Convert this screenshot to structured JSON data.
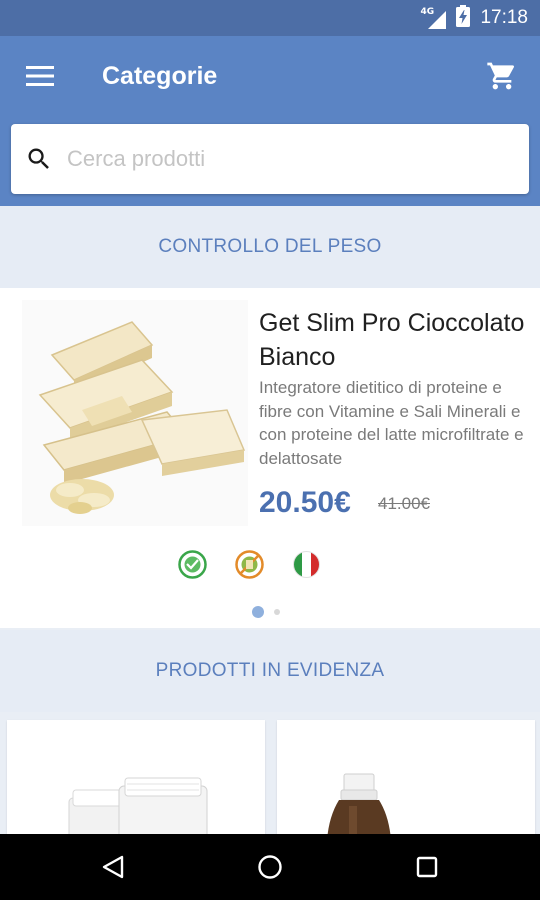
{
  "status_bar": {
    "network": "4G",
    "time": "17:18",
    "icons": [
      "signal-icon",
      "battery-charging-icon"
    ]
  },
  "app_bar": {
    "title": "Categorie",
    "icons": [
      "menu-icon",
      "cart-icon"
    ]
  },
  "search": {
    "placeholder": "Cerca prodotti",
    "value": ""
  },
  "sections": {
    "weight_control": "CONTROLLO DEL PESO",
    "featured": "PRODOTTI IN EVIDENZA"
  },
  "product": {
    "name": "Get Slim Pro Cioccolato Bianco",
    "description": "Integratore dietitico di proteine e fibre con Vitamine e Sali Minerali e con proteine del latte microfiltrate e delattosate",
    "price": "20.50€",
    "old_price": "41.00€",
    "badges": [
      "gluten-free-badge",
      "lactose-free-badge",
      "italy-flag-icon"
    ]
  },
  "carousel": {
    "pages": 2,
    "active_index": 0
  },
  "colors": {
    "primary": "#5b84c4",
    "primary_dark": "#4d6ea6",
    "section_bg": "#e6ecf5",
    "section_text": "#5b7fbd",
    "price": "#4b70b0"
  },
  "nav_bar": {
    "icons": [
      "back-icon",
      "home-icon",
      "recents-icon"
    ]
  }
}
